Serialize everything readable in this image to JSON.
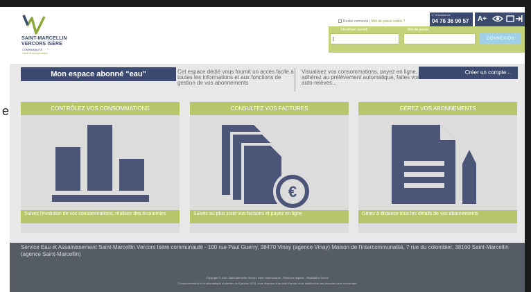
{
  "side_letter": "e",
  "logo": {
    "name_line1": "SAINT-MARCELLIN",
    "name_line2": "VERCORS ISÈRE",
    "sub_line1": "COMMUNAUTÉ",
    "sub_line2": "Vivre & entreprendre"
  },
  "login": {
    "remember_label": "Rester connecté",
    "separator": "|",
    "forgot_label": "Mot de passe oublié ?",
    "phone_label": "n° d'assistance",
    "phone": "04 76 36 90 57",
    "a_plus": "A+",
    "identifier_label": "Identifiant (email)",
    "password_label": "Mot de passe",
    "identifier_value": "|",
    "password_value": "",
    "submit_label": "CONNEXION"
  },
  "intro": {
    "title": "Mon espace abonné \"eau\"",
    "text_left": "Cet espace dédié vous fournit un accès facile à toutes les informations et aux fonctions de gestion de vos abonnements",
    "text_right": "Visualisez vos consommations, payez en ligne, adhérez au prélèvement automatique, faites vos auto-relèves...",
    "create_account": "Créer un compte..."
  },
  "cards": [
    {
      "title": "CONTRÔLEZ VOS CONSOMMATIONS",
      "icon": "bar-chart-icon",
      "description": "Suivez l'évolution de vos consommations, réalisez des économies"
    },
    {
      "title": "CONSULTEZ VOS FACTURES",
      "icon": "invoice-euro-icon",
      "description": "Suivez au plus juste vos factures et payez en ligne"
    },
    {
      "title": "GÉREZ VOS ABONNEMENTS",
      "icon": "document-pencil-icon",
      "description": "Gérez à distance tous les détails de vos abonnements"
    }
  ],
  "footer": {
    "address": "Service Eau et Assainissement Saint-Marcellin Vercors Isère communauté - 100 rue Paul Guerry, 38470 Vinay (agence Vinay) Maison de l'intercommunalité, 7 rue du colombier, 38160 Saint-Marcellin (agence Saint-Marcellin)",
    "copyright": "Copyright © 2017 Saint-Marcellin Vercors Isère communauté  -  Mentions légales  -  Réalisation Incom",
    "cnil": "Conformément à la loi informatique et libertés du 6 janvier 1978, vous disposez d'un droit d'accès et de rectification des données vous concernant"
  },
  "colors": {
    "navy": "#3b4a6e",
    "green": "#b5c76a",
    "light_green": "#c4d37a",
    "button_blue": "#9fd0e8",
    "footer_grey": "#555c66"
  }
}
